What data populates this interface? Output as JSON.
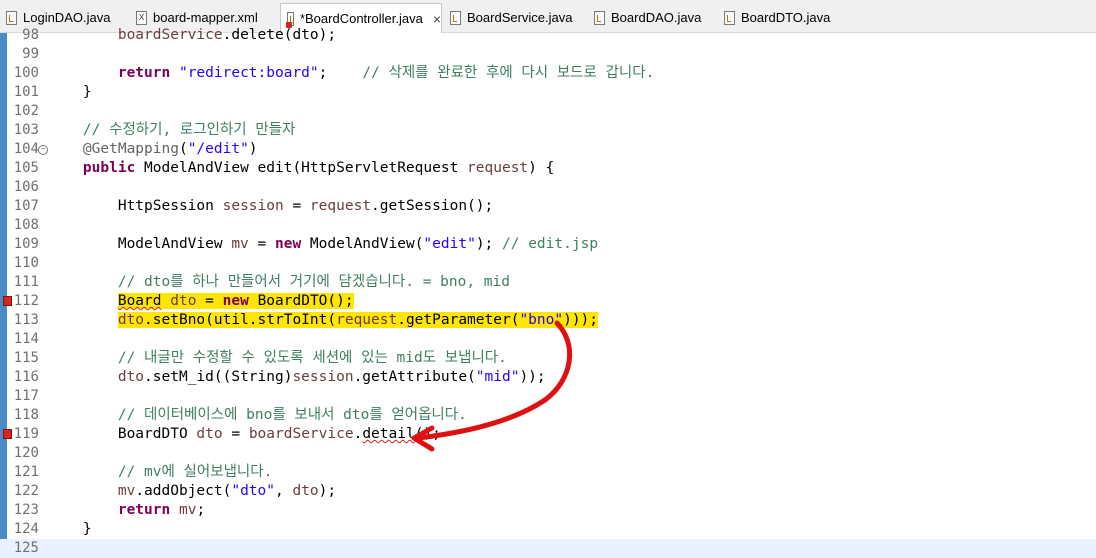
{
  "tabs": [
    {
      "label": "LoginDAO.java",
      "icon": "java-file-icon"
    },
    {
      "label": "board-mapper.xml",
      "icon": "xml-file-icon"
    },
    {
      "label": "*BoardController.java",
      "icon": "java-file-error-icon",
      "active": true
    },
    {
      "label": "BoardService.java",
      "icon": "java-file-icon"
    },
    {
      "label": "BoardDAO.java",
      "icon": "java-file-icon"
    },
    {
      "label": "BoardDTO.java",
      "icon": "java-file-icon"
    }
  ],
  "tab_close_glyph": "×",
  "lines": [
    {
      "n": "98",
      "segs": [
        [
          "",
          "        "
        ],
        [
          "var",
          "boardService"
        ],
        [
          "",
          ".delete(dto);"
        ]
      ]
    },
    {
      "n": "99",
      "segs": []
    },
    {
      "n": "100",
      "segs": [
        [
          "",
          "        "
        ],
        [
          "kw",
          "return"
        ],
        [
          "",
          " "
        ],
        [
          "str",
          "\"redirect:board\""
        ],
        [
          "",
          ";    "
        ],
        [
          "cm",
          "// 삭제를 완료한 후에 다시 보드로 갑니다."
        ]
      ]
    },
    {
      "n": "101",
      "segs": [
        [
          "",
          "    }"
        ]
      ]
    },
    {
      "n": "102",
      "segs": []
    },
    {
      "n": "103",
      "segs": [
        [
          "",
          "    "
        ],
        [
          "cm",
          "// 수정하기, 로그인하기 만들자"
        ]
      ]
    },
    {
      "n": "104",
      "segs": [
        [
          "",
          "    "
        ],
        [
          "ann",
          "@GetMapping"
        ],
        [
          "",
          "("
        ],
        [
          "str",
          "\"/edit\""
        ],
        [
          "",
          ")"
        ]
      ]
    },
    {
      "n": "105",
      "segs": [
        [
          "",
          "    "
        ],
        [
          "kw",
          "public"
        ],
        [
          "",
          " ModelAndView edit(HttpServletRequest "
        ],
        [
          "var",
          "request"
        ],
        [
          "",
          ") {"
        ]
      ]
    },
    {
      "n": "106",
      "segs": []
    },
    {
      "n": "107",
      "segs": [
        [
          "",
          "        HttpSession "
        ],
        [
          "var",
          "session"
        ],
        [
          "",
          " = "
        ],
        [
          "var",
          "request"
        ],
        [
          "",
          ".getSession();"
        ]
      ]
    },
    {
      "n": "108",
      "segs": []
    },
    {
      "n": "109",
      "segs": [
        [
          "",
          "        ModelAndView "
        ],
        [
          "var",
          "mv"
        ],
        [
          "",
          " = "
        ],
        [
          "kw",
          "new"
        ],
        [
          "",
          " ModelAndView("
        ],
        [
          "str",
          "\"edit\""
        ],
        [
          "",
          "); "
        ],
        [
          "cm",
          "// edit.jsp"
        ]
      ]
    },
    {
      "n": "110",
      "segs": []
    },
    {
      "n": "111",
      "segs": [
        [
          "",
          "        "
        ],
        [
          "cm",
          "// dto를 하나 만들어서 거기에 담겠습니다. = bno, mid"
        ]
      ]
    },
    {
      "n": "112",
      "segs": [
        [
          "",
          "        "
        ],
        [
          "hl squig",
          "Board"
        ],
        [
          "hl",
          " "
        ],
        [
          "hl var",
          "dto"
        ],
        [
          "hl",
          " = "
        ],
        [
          "hl kw",
          "new"
        ],
        [
          "hl",
          " BoardDTO();"
        ]
      ]
    },
    {
      "n": "113",
      "segs": [
        [
          "",
          "        "
        ],
        [
          "hl var",
          "dto"
        ],
        [
          "hl",
          ".setBno(util.strToInt("
        ],
        [
          "hl var",
          "request"
        ],
        [
          "hl",
          ".getParameter("
        ],
        [
          "hl str",
          "\"bno\""
        ],
        [
          "hl",
          ")));"
        ]
      ]
    },
    {
      "n": "114",
      "segs": []
    },
    {
      "n": "115",
      "segs": [
        [
          "",
          "        "
        ],
        [
          "cm",
          "// 내글만 수정할 수 있도록 세션에 있는 mid도 보냅니다."
        ]
      ]
    },
    {
      "n": "116",
      "segs": [
        [
          "",
          "        "
        ],
        [
          "var",
          "dto"
        ],
        [
          "",
          ".setM_id((String)"
        ],
        [
          "var",
          "session"
        ],
        [
          "",
          ".getAttribute("
        ],
        [
          "str",
          "\"mid\""
        ],
        [
          "",
          "));"
        ]
      ]
    },
    {
      "n": "117",
      "segs": []
    },
    {
      "n": "118",
      "segs": [
        [
          "",
          "        "
        ],
        [
          "cm",
          "// 데이터베이스에 bno를 보내서 dto를 얻어옵니다."
        ]
      ]
    },
    {
      "n": "119",
      "segs": [
        [
          "",
          "        BoardDTO "
        ],
        [
          "var",
          "dto"
        ],
        [
          "",
          " = "
        ],
        [
          "var",
          "boardService"
        ],
        [
          "",
          "."
        ],
        [
          "squig",
          "detail"
        ],
        [
          "",
          "();"
        ]
      ]
    },
    {
      "n": "120",
      "segs": []
    },
    {
      "n": "121",
      "segs": [
        [
          "",
          "        "
        ],
        [
          "cm",
          "// mv에 실어보냅니다."
        ]
      ]
    },
    {
      "n": "122",
      "segs": [
        [
          "",
          "        "
        ],
        [
          "var",
          "mv"
        ],
        [
          "",
          ".addObject("
        ],
        [
          "str",
          "\"dto\""
        ],
        [
          "",
          ", "
        ],
        [
          "var",
          "dto"
        ],
        [
          "",
          ");"
        ]
      ]
    },
    {
      "n": "123",
      "segs": [
        [
          "",
          "        "
        ],
        [
          "kw",
          "return"
        ],
        [
          "",
          " "
        ],
        [
          "var",
          "mv"
        ],
        [
          "",
          ";"
        ]
      ]
    },
    {
      "n": "124",
      "segs": [
        [
          "",
          "    }"
        ]
      ]
    },
    {
      "n": "125",
      "segs": []
    }
  ],
  "fold_line": "104",
  "error_lines": [
    "112",
    "119"
  ],
  "current_line": "125",
  "colors": {
    "annotation_arrow": "#e01010",
    "highlight": "#ffe600",
    "ruler": "#4a8bc3"
  }
}
